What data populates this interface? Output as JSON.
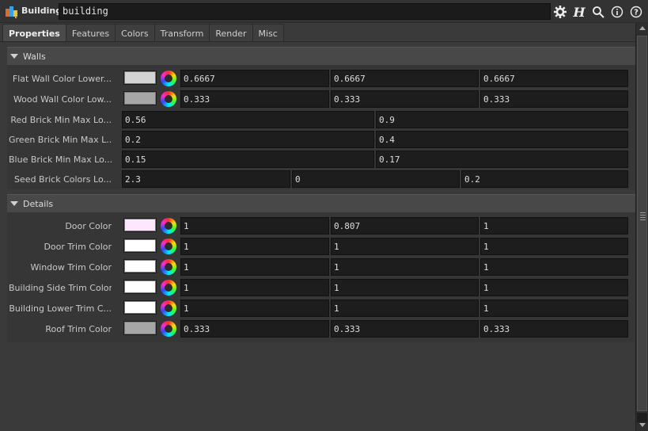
{
  "header": {
    "node_type": "Building",
    "node_name": "building",
    "icons": [
      "gear-icon",
      "houdini-help-icon",
      "search-icon",
      "info-icon",
      "help-icon"
    ]
  },
  "tabs": [
    {
      "label": "Properties",
      "active": true
    },
    {
      "label": "Features",
      "active": false
    },
    {
      "label": "Colors",
      "active": false
    },
    {
      "label": "Transform",
      "active": false
    },
    {
      "label": "Render",
      "active": false
    },
    {
      "label": "Misc",
      "active": false
    }
  ],
  "walls": {
    "title": "Walls",
    "flat_wall": {
      "label": "Flat Wall Color Lower...",
      "swatch": "#d4d4d4",
      "values": [
        "0.6667",
        "0.6667",
        "0.6667"
      ]
    },
    "wood_wall": {
      "label": "Wood Wall Color Low...",
      "swatch": "#a6a6a6",
      "values": [
        "0.333",
        "0.333",
        "0.333"
      ]
    },
    "red_brick": {
      "label": "Red Brick Min Max Lo...",
      "values": [
        "0.56",
        "0.9"
      ]
    },
    "green_brick": {
      "label": "Green Brick Min Max L...",
      "values": [
        "0.2",
        "0.4"
      ]
    },
    "blue_brick": {
      "label": "Blue Brick Min Max Lo...",
      "values": [
        "0.15",
        "0.17"
      ]
    },
    "seed_brick": {
      "label": "Seed Brick Colors Lo...",
      "values": [
        "2.3",
        "0",
        "0.2"
      ]
    }
  },
  "details": {
    "title": "Details",
    "door": {
      "label": "Door Color",
      "swatch": "#ffe6ff",
      "values": [
        "1",
        "0.807",
        "1"
      ]
    },
    "door_trim": {
      "label": "Door Trim Color",
      "swatch": "#ffffff",
      "values": [
        "1",
        "1",
        "1"
      ]
    },
    "window_trim": {
      "label": "Window Trim Color",
      "swatch": "#ffffff",
      "values": [
        "1",
        "1",
        "1"
      ]
    },
    "side_trim": {
      "label": "Building Side Trim Color",
      "swatch": "#ffffff",
      "values": [
        "1",
        "1",
        "1"
      ]
    },
    "lower_trim": {
      "label": "Building Lower Trim C...",
      "swatch": "#ffffff",
      "values": [
        "1",
        "1",
        "1"
      ]
    },
    "roof_trim": {
      "label": "Roof Trim Color",
      "swatch": "#a6a6a6",
      "values": [
        "0.333",
        "0.333",
        "0.333"
      ]
    }
  }
}
